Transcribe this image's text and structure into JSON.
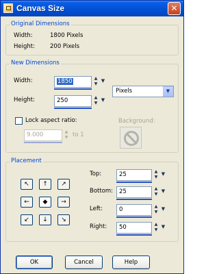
{
  "window": {
    "title": "Canvas Size",
    "close_glyph": "✕"
  },
  "original_dimensions": {
    "legend": "Original Dimensions",
    "width_label": "Width:",
    "width_value": "1800 Pixels",
    "height_label": "Height:",
    "height_value": "200 Pixels"
  },
  "new_dimensions": {
    "legend": "New Dimensions",
    "width_label": "Width:",
    "width_value": "1850",
    "height_label": "Height:",
    "height_value": "250",
    "units": "Pixels",
    "lock_label": "Lock aspect ratio:",
    "lock_checked": false,
    "ratio_value": "9.000",
    "ratio_suffix": "to 1",
    "background_label": "Background:"
  },
  "placement": {
    "legend": "Placement",
    "anchors": [
      "↖",
      "↑",
      "↗",
      "←",
      "◆",
      "→",
      "↙",
      "↓",
      "↘"
    ],
    "top_label": "Top:",
    "top_value": "25",
    "bottom_label": "Bottom:",
    "bottom_value": "25",
    "left_label": "Left:",
    "left_value": "0",
    "right_label": "Right:",
    "right_value": "50"
  },
  "buttons": {
    "ok": "OK",
    "cancel": "Cancel",
    "help": "Help"
  },
  "icons": {
    "spin_up": "▲",
    "spin_down": "▼",
    "dropdown": "▼",
    "select_arrow": "▼"
  },
  "colors": {
    "title_bar": "#0054e3",
    "group_legend": "#0046d5",
    "dialog_bg": "#ece9d8"
  }
}
